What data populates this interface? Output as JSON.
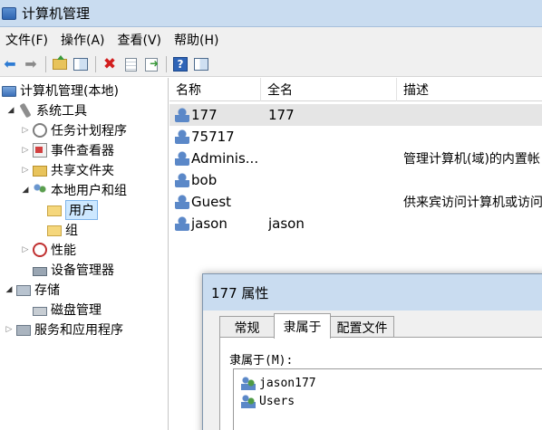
{
  "window": {
    "title": "计算机管理"
  },
  "menu": [
    "文件(F)",
    "操作(A)",
    "查看(V)",
    "帮助(H)"
  ],
  "toolbar": {
    "buttons": [
      "back-arrow-icon",
      "forward-arrow-icon",
      "folder-up-icon",
      "show-hide-tree-icon",
      "delete-icon",
      "properties-icon",
      "export-list-icon",
      "help-icon",
      "show-hide-action-pane-icon"
    ]
  },
  "tree": {
    "root": "计算机管理(本地)",
    "system_tools": "系统工具",
    "task_scheduler": "任务计划程序",
    "event_viewer": "事件查看器",
    "shared_folders": "共享文件夹",
    "local_users_groups": "本地用户和组",
    "users": "用户",
    "groups": "组",
    "performance": "性能",
    "device_manager": "设备管理器",
    "storage": "存储",
    "disk_management": "磁盘管理",
    "services_apps": "服务和应用程序"
  },
  "list": {
    "columns": [
      "名称",
      "全名",
      "描述"
    ],
    "rows": [
      {
        "name": "177",
        "fullname": "177",
        "description": ""
      },
      {
        "name": "75717",
        "fullname": "",
        "description": ""
      },
      {
        "name": "Adminis...",
        "fullname": "",
        "description": "管理计算机(域)的内置帐"
      },
      {
        "name": "bob",
        "fullname": "",
        "description": ""
      },
      {
        "name": "Guest",
        "fullname": "",
        "description": "供来宾访问计算机或访问"
      },
      {
        "name": "jason",
        "fullname": "jason",
        "description": ""
      }
    ]
  },
  "dialog": {
    "title": "177 属性",
    "tabs": [
      "常规",
      "隶属于",
      "配置文件"
    ],
    "active_tab": "隶属于",
    "member_of_label": "隶属于(M):",
    "members": [
      "jason177",
      "Users"
    ]
  }
}
